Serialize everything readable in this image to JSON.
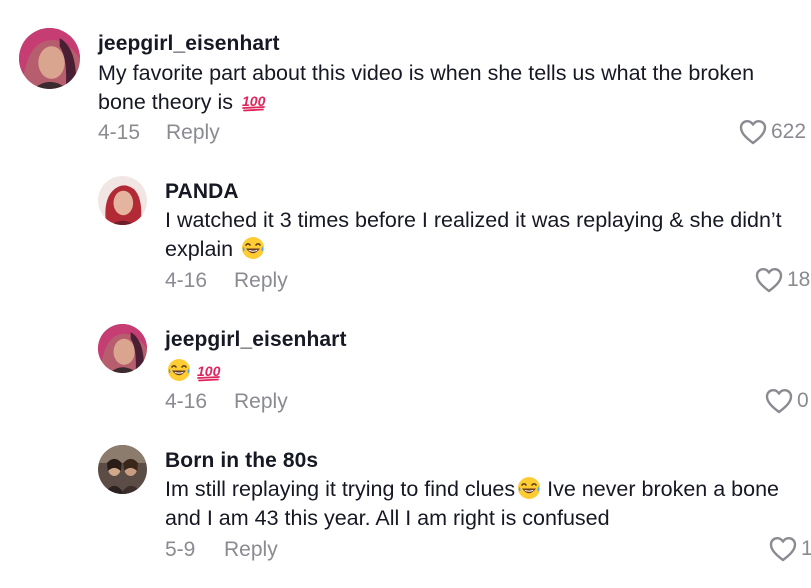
{
  "comments": [
    {
      "username": "jeepgirl_eisenhart",
      "text": "My favorite part about this video is when she tells us what the broken bone theory is",
      "date": "4-15",
      "reply_label": "Reply",
      "likes": "622",
      "emojis": [
        "hundred-points"
      ]
    },
    {
      "username": "PANDA",
      "text": "I watched it 3 times before I realized it was replaying & she didn’t explain",
      "date": "4-16",
      "reply_label": "Reply",
      "likes": "18",
      "emojis": [
        "tears-of-joy"
      ]
    },
    {
      "username": "jeepgirl_eisenhart",
      "text": "",
      "date": "4-16",
      "reply_label": "Reply",
      "likes": "0",
      "emojis": [
        "tears-of-joy",
        "hundred-points"
      ]
    },
    {
      "username": "Born in the 80s",
      "text_part1": "Im still replaying it trying to find clues",
      "text_part2": " Ive never broken a bone and I am 43 this year. All I am right is confused",
      "date": "5-9",
      "reply_label": "Reply",
      "likes": "1",
      "emojis": [
        "tears-of-joy"
      ]
    }
  ],
  "icons": {
    "like": "heart-outline-icon",
    "hundred": "hundred-points-emoji",
    "laugh": "tears-of-joy-emoji"
  },
  "colors": {
    "text_primary": "#161823",
    "text_secondary": "#8a8b91",
    "emoji_red": "#e0245e",
    "emoji_yellow": "#ffcc33"
  }
}
